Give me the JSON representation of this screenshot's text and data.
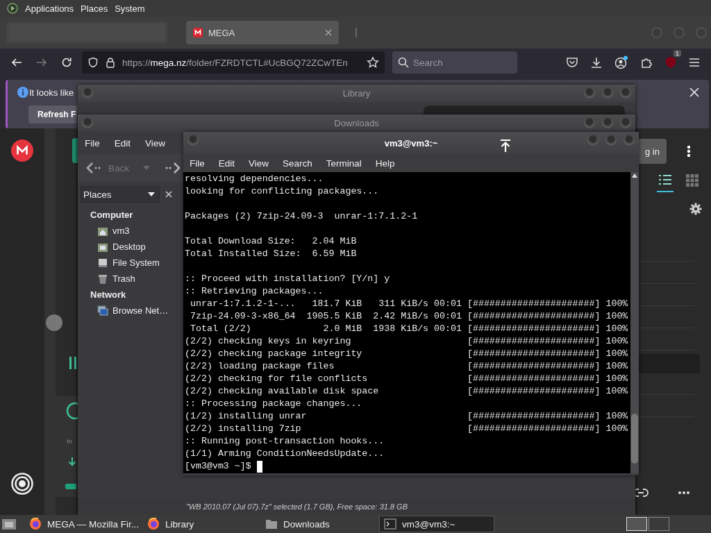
{
  "top_panel": {
    "menus": [
      "Applications",
      "Places",
      "System"
    ]
  },
  "browser": {
    "tabs": [
      {
        "label": "MEGA",
        "selected": true
      }
    ],
    "url": {
      "scheme": "https://",
      "host": "mega.nz",
      "path": "/folder/FZRDTCTL#UcBGQ72ZCwTEn"
    },
    "search": {
      "placeholder": "Search"
    },
    "extension_badge": "1",
    "notification": {
      "text": "It looks like",
      "button": "Refresh F"
    },
    "page": {
      "login_button": "g in",
      "views": [
        {
          "kind": "list",
          "selected": true
        },
        {
          "kind": "grid",
          "selected": false
        }
      ],
      "transfer_label": "In"
    }
  },
  "library_window": {
    "title": "Library"
  },
  "downloads_window": {
    "title": "Downloads",
    "menus": [
      "File",
      "Edit",
      "View"
    ],
    "back_button": {
      "label": "Back",
      "disabled": true
    },
    "sidebar": {
      "selector": "Places",
      "groups": [
        {
          "label": "Computer",
          "items": [
            {
              "label": "vm3",
              "kind": "home"
            },
            {
              "label": "Desktop",
              "kind": "desktop"
            },
            {
              "label": "File System",
              "kind": "drive"
            },
            {
              "label": "Trash",
              "kind": "trash"
            }
          ]
        },
        {
          "label": "Network",
          "items": [
            {
              "label": "Browse Net…",
              "kind": "network"
            }
          ]
        }
      ]
    },
    "status": "\"WB 2010.07 (Jul 07).7z\" selected (1.7 GB), Free space: 31.8 GB"
  },
  "terminal": {
    "title": "vm3@vm3:~",
    "menus": [
      "File",
      "Edit",
      "View",
      "Search",
      "Terminal",
      "Help"
    ],
    "blocks": [
      [
        {
          "text": "resolving dependencies..."
        },
        {
          "text": "looking for conflicting packages..."
        }
      ],
      [
        {
          "text": "Packages (2) 7zip-24.09-3  unrar-1:7.1.2-1"
        }
      ],
      [
        {
          "text": "Total Download Size:   2.04 MiB"
        },
        {
          "text": "Total Installed Size:  6.59 MiB"
        }
      ],
      [
        {
          "text": ":: Proceed with installation? [Y/n] y"
        },
        {
          "text": ":: Retrieving packages..."
        },
        {
          "text": " unrar-1:7.1.2-1-...   181.7 KiB   311 KiB/s 00:01",
          "bar": "[######################] 100%"
        },
        {
          "text": " 7zip-24.09-3-x86_64  1905.5 KiB  2.42 MiB/s 00:01",
          "bar": "[######################] 100%"
        },
        {
          "text": " Total (2/2)             2.0 MiB  1938 KiB/s 00:01",
          "bar": "[######################] 100%"
        },
        {
          "text": "(2/2) checking keys in keyring",
          "bar": "[######################] 100%"
        },
        {
          "text": "(2/2) checking package integrity",
          "bar": "[######################] 100%"
        },
        {
          "text": "(2/2) loading package files",
          "bar": "[######################] 100%"
        },
        {
          "text": "(2/2) checking for file conflicts",
          "bar": "[######################] 100%"
        },
        {
          "text": "(2/2) checking available disk space",
          "bar": "[######################] 100%"
        },
        {
          "text": ":: Processing package changes..."
        },
        {
          "text": "(1/2) installing unrar",
          "bar": "[######################] 100%"
        },
        {
          "text": "(2/2) installing 7zip",
          "bar": "[######################] 100%"
        },
        {
          "text": ":: Running post-transaction hooks..."
        },
        {
          "text": "(1/1) Arming ConditionNeedsUpdate..."
        }
      ]
    ],
    "prompt": "[vm3@vm3 ~]$"
  },
  "taskbar": {
    "items": [
      {
        "label": "MEGA — Mozilla Fir...",
        "kind": "browser",
        "selected": false
      },
      {
        "label": "Library",
        "kind": "browser",
        "selected": false
      },
      {
        "label": "Downloads",
        "kind": "folder",
        "selected": false
      },
      {
        "label": "vm3@vm3:~",
        "kind": "terminal",
        "selected": true
      }
    ]
  }
}
